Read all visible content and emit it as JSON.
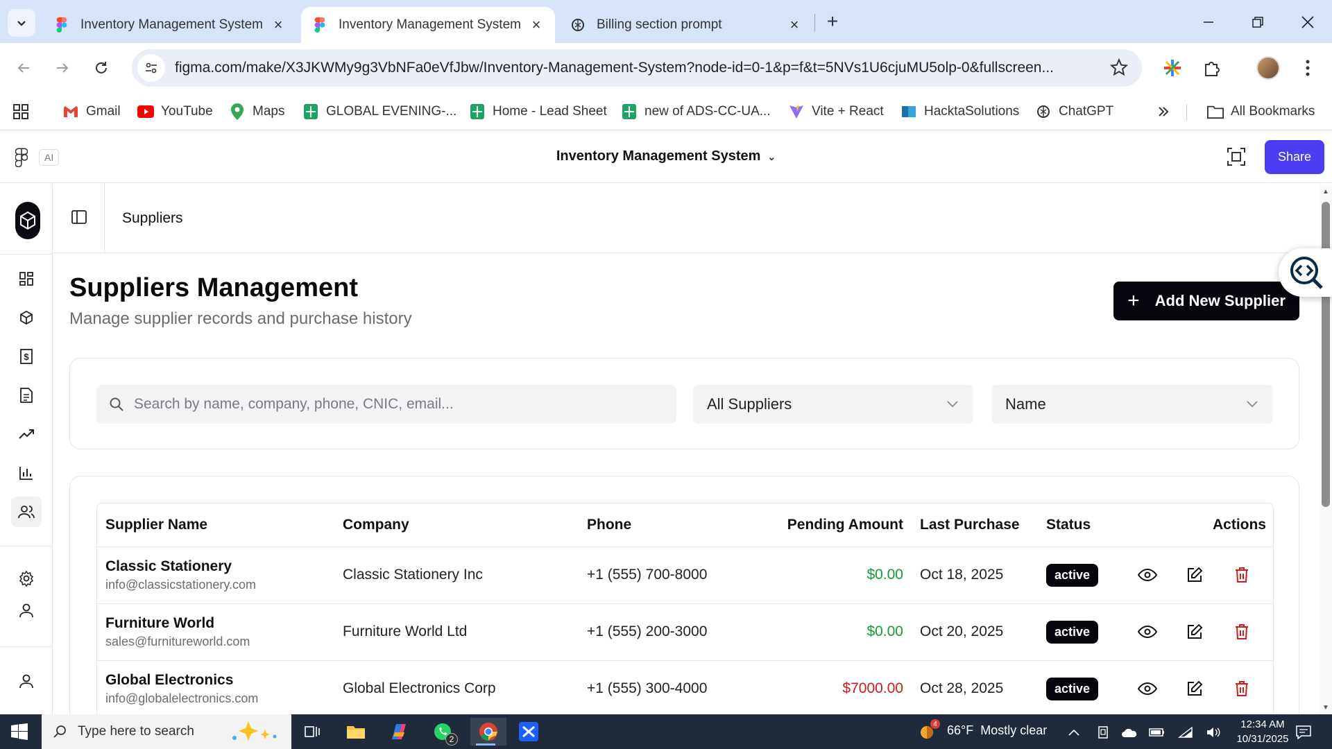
{
  "browser": {
    "tabs": [
      {
        "title": "Inventory Management System",
        "icon": "figma-icon",
        "active": false
      },
      {
        "title": "Inventory Management System",
        "icon": "figma-icon",
        "active": true
      },
      {
        "title": "Billing section prompt",
        "icon": "chatgpt-icon",
        "active": false
      }
    ],
    "url": "figma.com/make/X3JKWMy9g3VbNFa0eVfJbw/Inventory-Management-System?node-id=0-1&p=f&t=5NVs1U6cjuMU5olp-0&fullscreen...",
    "bookmarks": [
      {
        "label": "Gmail",
        "icon": "gmail-icon"
      },
      {
        "label": "YouTube",
        "icon": "youtube-icon"
      },
      {
        "label": "Maps",
        "icon": "maps-icon"
      },
      {
        "label": "GLOBAL EVENING-...",
        "icon": "sheets-icon"
      },
      {
        "label": "Home - Lead Sheet",
        "icon": "sheets-icon"
      },
      {
        "label": "new of ADS-CC-UA...",
        "icon": "sheets-icon"
      },
      {
        "label": "Vite + React",
        "icon": "vite-icon"
      },
      {
        "label": "HacktaSolutions",
        "icon": "hackta-icon"
      },
      {
        "label": "ChatGPT",
        "icon": "chatgpt-icon"
      }
    ],
    "all_bookmarks": "All Bookmarks"
  },
  "figma": {
    "ai_badge": "AI",
    "project_title": "Inventory Management System",
    "share_label": "Share"
  },
  "page": {
    "breadcrumb": "Suppliers",
    "title": "Suppliers Management",
    "subtitle": "Manage supplier records and purchase history",
    "add_button": "Add New Supplier",
    "search_placeholder": "Search by name, company, phone, CNIC, email...",
    "filter_select": "All Suppliers",
    "sort_select": "Name"
  },
  "table": {
    "headers": {
      "name": "Supplier Name",
      "company": "Company",
      "phone": "Phone",
      "pending": "Pending Amount",
      "last": "Last Purchase",
      "status": "Status",
      "actions": "Actions"
    },
    "rows": [
      {
        "name": "Classic Stationery",
        "email": "info@classicstationery.com",
        "company": "Classic Stationery Inc",
        "phone": "+1 (555) 700-8000",
        "pending": "$0.00",
        "last": "Oct 18, 2025",
        "status": "active"
      },
      {
        "name": "Furniture World",
        "email": "sales@furnitureworld.com",
        "company": "Furniture World Ltd",
        "phone": "+1 (555) 200-3000",
        "pending": "$0.00",
        "last": "Oct 20, 2025",
        "status": "active"
      },
      {
        "name": "Global Electronics",
        "email": "info@globalelectronics.com",
        "company": "Global Electronics Corp",
        "phone": "+1 (555) 300-4000",
        "pending": "$7000.00",
        "last": "Oct 28, 2025",
        "status": "active"
      }
    ]
  },
  "colors": {
    "accent": "#4a3df2",
    "positive": "#1a9a3a",
    "negative": "#d11a1a",
    "dark": "#05050d"
  },
  "taskbar": {
    "search_placeholder": "Type here to search",
    "weather_temp": "66°F",
    "weather_desc": "Mostly clear",
    "time": "12:34 AM",
    "date": "10/31/2025",
    "whatsapp_badge": "2",
    "weather_badge": "4"
  }
}
